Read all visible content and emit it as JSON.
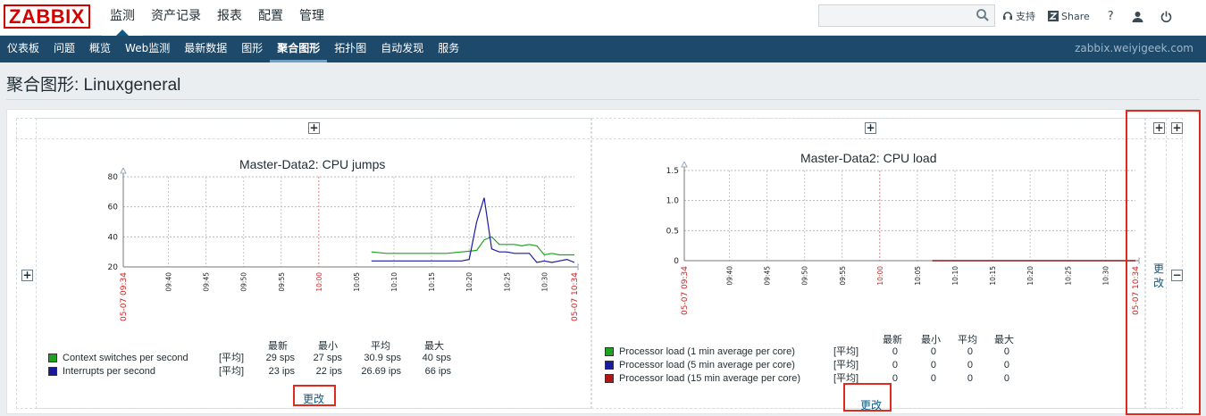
{
  "brand": "ZABBIX",
  "main_menu": [
    {
      "label": "监测",
      "active": true
    },
    {
      "label": "资产记录",
      "active": false
    },
    {
      "label": "报表",
      "active": false
    },
    {
      "label": "配置",
      "active": false
    },
    {
      "label": "管理",
      "active": false
    }
  ],
  "search": {
    "value": "",
    "placeholder": ""
  },
  "top_links": {
    "support": "支持",
    "share": "Share",
    "help": "?"
  },
  "sub_menu": [
    {
      "label": "仪表板",
      "active": false
    },
    {
      "label": "问题",
      "active": false
    },
    {
      "label": "概览",
      "active": false
    },
    {
      "label": "Web监测",
      "active": false
    },
    {
      "label": "最新数据",
      "active": false
    },
    {
      "label": "图形",
      "active": false
    },
    {
      "label": "聚合图形",
      "active": true
    },
    {
      "label": "拓扑图",
      "active": false
    },
    {
      "label": "自动发现",
      "active": false
    },
    {
      "label": "服务",
      "active": false
    }
  ],
  "host_link": "zabbix.weiyigeek.com",
  "page_title": "聚合图形: Linuxgeneral",
  "change_label": "更改",
  "change_label_vertical": [
    "更",
    "改"
  ],
  "colors": {
    "green": "#1fa21f",
    "blue": "#1a1aa0",
    "red": "#b21515",
    "accent": "#0e5a84",
    "highlight": "#e02a20"
  },
  "chart_data": [
    {
      "type": "line",
      "title": "Master-Data2: CPU jumps",
      "ylim": [
        20,
        80
      ],
      "y_ticks": [
        "80",
        "60",
        "40",
        "20"
      ],
      "x_start_label": "05-07 09:34",
      "x_end_label": "05-07 10:34",
      "x_ticks": [
        "09:40",
        "09:45",
        "09:50",
        "09:55",
        "10:00",
        "10:05",
        "10:10",
        "10:15",
        "10:20",
        "10:25",
        "10:30"
      ],
      "x_red_tick": "10:00",
      "legend_headers": [
        "最新",
        "最小",
        "平均",
        "最大"
      ],
      "series": [
        {
          "name": "Context switches per second",
          "func": "[平均]",
          "color": "#1fa21f",
          "last": "29 sps",
          "min": "27 sps",
          "avg": "30.9 sps",
          "max": "40 sps",
          "x": [
            33,
            35,
            38,
            40,
            43,
            45,
            47,
            48,
            49,
            50,
            51,
            52,
            53,
            54,
            55,
            56,
            57,
            58,
            60
          ],
          "values": [
            30,
            29,
            29,
            29,
            29,
            30,
            31,
            38,
            40,
            35,
            35,
            35,
            34,
            35,
            34,
            28,
            29,
            28,
            28
          ]
        },
        {
          "name": "Interrupts per second",
          "func": "[平均]",
          "color": "#1a1aa0",
          "last": "23 ips",
          "min": "22 ips",
          "avg": "26.69 ips",
          "max": "66 ips",
          "x": [
            33,
            35,
            38,
            40,
            43,
            45,
            46,
            47,
            48,
            49,
            50,
            51,
            52,
            53,
            54,
            55,
            56,
            57,
            58,
            59,
            60
          ],
          "values": [
            24,
            24,
            24,
            24,
            24,
            24,
            25,
            50,
            66,
            32,
            30,
            30,
            29,
            29,
            29,
            23,
            24,
            23,
            24,
            25,
            23
          ]
        }
      ]
    },
    {
      "type": "line",
      "title": "Master-Data2: CPU load",
      "ylim": [
        0,
        1.5
      ],
      "y_ticks": [
        "1.5",
        "1.0",
        "0.5",
        "0"
      ],
      "x_start_label": "05-07 09:34",
      "x_end_label": "05-07 10:34",
      "x_ticks": [
        "09:40",
        "09:45",
        "09:50",
        "09:55",
        "10:00",
        "10:05",
        "10:10",
        "10:15",
        "10:20",
        "10:25",
        "10:30"
      ],
      "x_red_tick": "10:00",
      "legend_headers": [
        "最新",
        "最小",
        "平均",
        "最大"
      ],
      "series": [
        {
          "name": "Processor load (1 min average per core)",
          "func": "[平均]",
          "color": "#1fa21f",
          "last": "0",
          "min": "0",
          "avg": "0",
          "max": "0",
          "x": [
            33,
            60
          ],
          "values": [
            0,
            0
          ]
        },
        {
          "name": "Processor load (5 min average per core)",
          "func": "[平均]",
          "color": "#1a1aa0",
          "last": "0",
          "min": "0",
          "avg": "0",
          "max": "0",
          "x": [
            33,
            60
          ],
          "values": [
            0,
            0
          ]
        },
        {
          "name": "Processor load (15 min average per core)",
          "func": "[平均]",
          "color": "#b21515",
          "last": "0",
          "min": "0",
          "avg": "0",
          "max": "0",
          "x": [
            33,
            60
          ],
          "values": [
            0,
            0
          ]
        }
      ]
    }
  ]
}
